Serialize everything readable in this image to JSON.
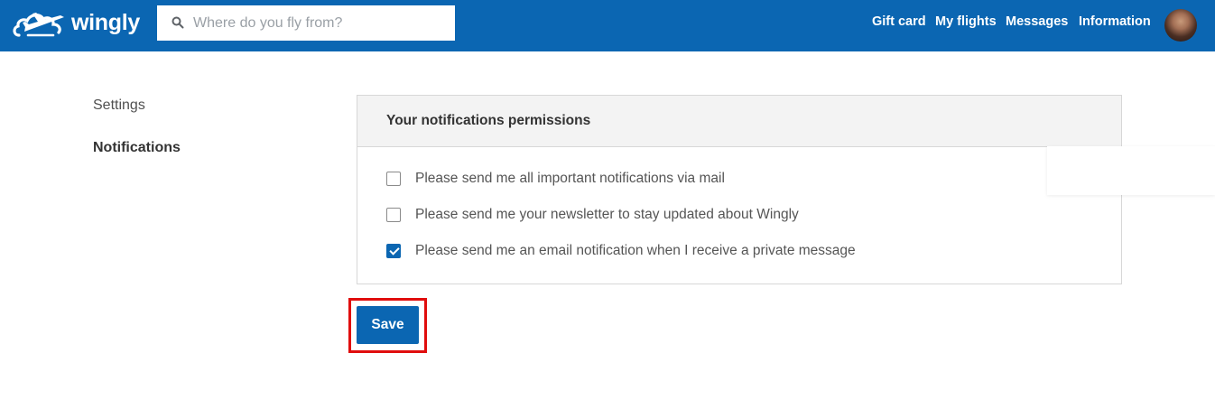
{
  "header": {
    "brand": "wingly",
    "search": {
      "placeholder": "Where do you fly from?",
      "value": ""
    },
    "nav": {
      "gift_card": "Gift card",
      "my_flights": "My flights",
      "messages": "Messages",
      "information": "Information"
    },
    "colors": {
      "bar": "#0b66b2",
      "text": "#ffffff"
    },
    "icons": {
      "logo": "plane-cloud-logo",
      "search": "search-icon",
      "avatar": "user-avatar"
    }
  },
  "sidebar": {
    "heading": "Settings",
    "active_item": "Notifications"
  },
  "panel": {
    "title": "Your notifications permissions",
    "options": [
      {
        "label": "Please send me all important notifications via mail",
        "checked": false
      },
      {
        "label": "Please send me your newsletter to stay updated about Wingly",
        "checked": false
      },
      {
        "label": "Please send me an email notification when I receive a private message",
        "checked": true
      }
    ]
  },
  "actions": {
    "save_label": "Save",
    "highlight_color": "#e00d0d"
  }
}
